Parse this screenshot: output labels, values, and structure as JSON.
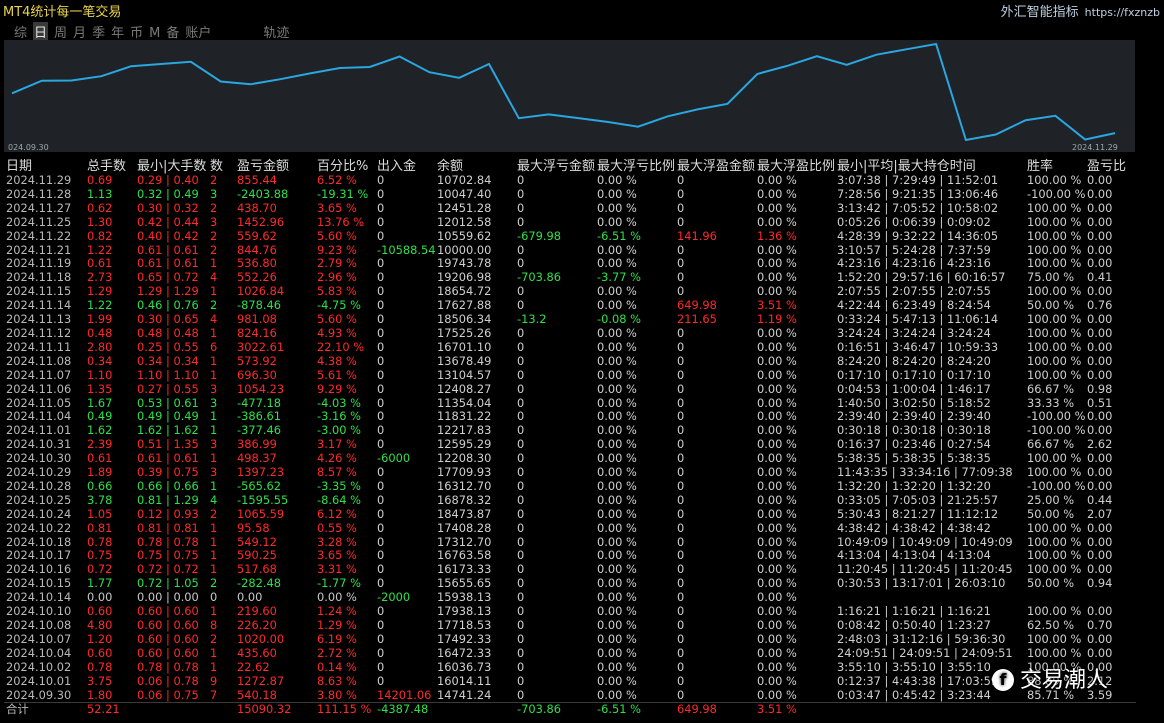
{
  "app_title": "MT4统计每一笔交易",
  "brand": "外汇智能指标",
  "brand_url": "https://fxznzb",
  "menu": [
    {
      "label": "综",
      "active": false
    },
    {
      "label": "日",
      "active": true
    },
    {
      "label": "周",
      "active": false
    },
    {
      "label": "月",
      "active": false
    },
    {
      "label": "季",
      "active": false
    },
    {
      "label": "年",
      "active": false
    },
    {
      "label": "币",
      "active": false
    },
    {
      "label": "M",
      "active": false
    },
    {
      "label": "备",
      "active": false
    },
    {
      "label": "账户",
      "active": false
    },
    {
      "label": "轨迹",
      "active": false,
      "gap": true
    }
  ],
  "chart_data": {
    "type": "line",
    "x_start_label": "024.09.30",
    "x_end_label": "2024.11.29",
    "x": [
      "2024.09.30",
      "2024.10.01",
      "2024.10.02",
      "2024.10.04",
      "2024.10.07",
      "2024.10.08",
      "2024.10.10",
      "2024.10.14",
      "2024.10.15",
      "2024.10.16",
      "2024.10.17",
      "2024.10.18",
      "2024.10.22",
      "2024.10.24",
      "2024.10.25",
      "2024.10.28",
      "2024.10.29",
      "2024.10.30",
      "2024.10.31",
      "2024.11.01",
      "2024.11.04",
      "2024.11.05",
      "2024.11.06",
      "2024.11.07",
      "2024.11.08",
      "2024.11.11",
      "2024.11.12",
      "2024.11.13",
      "2024.11.14",
      "2024.11.15",
      "2024.11.18",
      "2024.11.19",
      "2024.11.21",
      "2024.11.22",
      "2024.11.25",
      "2024.11.27",
      "2024.11.28",
      "2024.11.29"
    ],
    "values": [
      14741.24,
      16014.11,
      16036.73,
      16472.33,
      17492.33,
      17718.53,
      17938.13,
      15938.13,
      15655.65,
      16173.33,
      16763.58,
      17312.7,
      17408.28,
      18473.87,
      16878.32,
      16312.7,
      17709.93,
      12208.3,
      12595.29,
      12217.83,
      11831.22,
      11354.04,
      12408.27,
      13104.57,
      13678.49,
      16701.1,
      17525.26,
      18506.34,
      17627.88,
      18654.72,
      19206.98,
      19743.78,
      10000.0,
      10559.62,
      12012.58,
      12451.28,
      10047.4,
      10702.84
    ],
    "line_color": "#2aa6e0",
    "background": "#1f2226"
  },
  "table": {
    "columns": [
      "日期",
      "总手数",
      "最小|大手数",
      "数",
      "盈亏金额",
      "百分比%",
      "出入金",
      "余额",
      "最大浮亏金额",
      "最大浮亏比例",
      "最大浮盈金额",
      "最大浮盈比例",
      "最小|平均|最大持仓时间",
      "胜率",
      "盈亏比"
    ],
    "rows": [
      {
        "date": "2024.11.29",
        "lots": "0.69",
        "minmax": "0.29 | 0.40",
        "n": "2",
        "pl": "855.44",
        "pct": "6.52 %",
        "flow": "0",
        "bal": "10702.84",
        "mfl": "0",
        "mflp": "0.00 %",
        "mfp": "0",
        "mfpp": "0.00 %",
        "time": "3:07:38 | 7:29:49 | 11:52:01",
        "win": "100.00 %",
        "rr": "0.00",
        "sign": "neg"
      },
      {
        "date": "2024.11.28",
        "lots": "1.13",
        "minmax": "0.32 | 0.49",
        "n": "3",
        "pl": "-2403.88",
        "pct": "-19.31 %",
        "flow": "0",
        "bal": "10047.40",
        "mfl": "0",
        "mflp": "0.00 %",
        "mfp": "0",
        "mfpp": "0.00 %",
        "time": "7:28:56 | 9:21:35 | 13:06:46",
        "win": "-100.00 %",
        "rr": "0.00",
        "sign": "pos"
      },
      {
        "date": "2024.11.27",
        "lots": "0.62",
        "minmax": "0.30 | 0.32",
        "n": "2",
        "pl": "438.70",
        "pct": "3.65 %",
        "flow": "0",
        "bal": "12451.28",
        "mfl": "0",
        "mflp": "0.00 %",
        "mfp": "0",
        "mfpp": "0.00 %",
        "time": "3:13:42 | 7:05:52 | 10:58:02",
        "win": "100.00 %",
        "rr": "0.00",
        "sign": "neg"
      },
      {
        "date": "2024.11.25",
        "lots": "1.30",
        "minmax": "0.42 | 0.44",
        "n": "3",
        "pl": "1452.96",
        "pct": "13.76 %",
        "flow": "0",
        "bal": "12012.58",
        "mfl": "0",
        "mflp": "0.00 %",
        "mfp": "0",
        "mfpp": "0.00 %",
        "time": "0:05:26 | 0:06:39 | 0:09:02",
        "win": "100.00 %",
        "rr": "0.00",
        "sign": "neg"
      },
      {
        "date": "2024.11.22",
        "lots": "0.82",
        "minmax": "0.40 | 0.42",
        "n": "2",
        "pl": "559.62",
        "pct": "5.60 %",
        "flow": "0",
        "bal": "10559.62",
        "mfl": "-679.98",
        "mflp": "-6.51 %",
        "mfp": "141.96",
        "mfpp": "1.36 %",
        "time": "4:28:39 | 9:32:22 | 14:36:05",
        "win": "100.00 %",
        "rr": "0.00",
        "sign": "neg"
      },
      {
        "date": "2024.11.21",
        "lots": "1.22",
        "minmax": "0.61 | 0.61",
        "n": "2",
        "pl": "844.76",
        "pct": "9.23 %",
        "flow": "-10588.54",
        "bal": "10000.00",
        "mfl": "0",
        "mflp": "0.00 %",
        "mfp": "0",
        "mfpp": "0.00 %",
        "time": "3:10:57 | 5:24:28 | 7:37:59",
        "win": "100.00 %",
        "rr": "0.00",
        "sign": "neg"
      },
      {
        "date": "2024.11.19",
        "lots": "0.61",
        "minmax": "0.61 | 0.61",
        "n": "1",
        "pl": "536.80",
        "pct": "2.79 %",
        "flow": "0",
        "bal": "19743.78",
        "mfl": "0",
        "mflp": "0.00 %",
        "mfp": "0",
        "mfpp": "0.00 %",
        "time": "4:23:16 | 4:23:16 | 4:23:16",
        "win": "100.00 %",
        "rr": "0.00",
        "sign": "neg"
      },
      {
        "date": "2024.11.18",
        "lots": "2.73",
        "minmax": "0.65 | 0.72",
        "n": "4",
        "pl": "552.26",
        "pct": "2.96 %",
        "flow": "0",
        "bal": "19206.98",
        "mfl": "-703.86",
        "mflp": "-3.77 %",
        "mfp": "0",
        "mfpp": "0.00 %",
        "time": "1:52:20 | 29:57:16 | 60:16:57",
        "win": "75.00 %",
        "rr": "0.41",
        "sign": "neg"
      },
      {
        "date": "2024.11.15",
        "lots": "1.29",
        "minmax": "1.29 | 1.29",
        "n": "1",
        "pl": "1026.84",
        "pct": "5.83 %",
        "flow": "0",
        "bal": "18654.72",
        "mfl": "0",
        "mflp": "0.00 %",
        "mfp": "0",
        "mfpp": "0.00 %",
        "time": "2:07:55 | 2:07:55 | 2:07:55",
        "win": "100.00 %",
        "rr": "0.00",
        "sign": "neg"
      },
      {
        "date": "2024.11.14",
        "lots": "1.22",
        "minmax": "0.46 | 0.76",
        "n": "2",
        "pl": "-878.46",
        "pct": "-4.75 %",
        "flow": "0",
        "bal": "17627.88",
        "mfl": "0",
        "mflp": "0.00 %",
        "mfp": "649.98",
        "mfpp": "3.51 %",
        "time": "4:22:44 | 6:23:49 | 8:24:54",
        "win": "50.00 %",
        "rr": "0.76",
        "sign": "pos"
      },
      {
        "date": "2024.11.13",
        "lots": "1.99",
        "minmax": "0.30 | 0.65",
        "n": "4",
        "pl": "981.08",
        "pct": "5.60 %",
        "flow": "0",
        "bal": "18506.34",
        "mfl": "-13.2",
        "mflp": "-0.08 %",
        "mfp": "211.65",
        "mfpp": "1.19 %",
        "time": "0:33:24 | 5:47:13 | 11:06:14",
        "win": "100.00 %",
        "rr": "0.00",
        "sign": "neg"
      },
      {
        "date": "2024.11.12",
        "lots": "0.48",
        "minmax": "0.48 | 0.48",
        "n": "1",
        "pl": "824.16",
        "pct": "4.93 %",
        "flow": "0",
        "bal": "17525.26",
        "mfl": "0",
        "mflp": "0.00 %",
        "mfp": "0",
        "mfpp": "0.00 %",
        "time": "3:24:24 | 3:24:24 | 3:24:24",
        "win": "100.00 %",
        "rr": "0.00",
        "sign": "neg"
      },
      {
        "date": "2024.11.11",
        "lots": "2.80",
        "minmax": "0.25 | 0.55",
        "n": "6",
        "pl": "3022.61",
        "pct": "22.10 %",
        "flow": "0",
        "bal": "16701.10",
        "mfl": "0",
        "mflp": "0.00 %",
        "mfp": "0",
        "mfpp": "0.00 %",
        "time": "0:16:51 | 3:46:47 | 10:59:33",
        "win": "100.00 %",
        "rr": "0.00",
        "sign": "neg"
      },
      {
        "date": "2024.11.08",
        "lots": "0.34",
        "minmax": "0.34 | 0.34",
        "n": "1",
        "pl": "573.92",
        "pct": "4.38 %",
        "flow": "0",
        "bal": "13678.49",
        "mfl": "0",
        "mflp": "0.00 %",
        "mfp": "0",
        "mfpp": "0.00 %",
        "time": "8:24:20 | 8:24:20 | 8:24:20",
        "win": "100.00 %",
        "rr": "0.00",
        "sign": "neg"
      },
      {
        "date": "2024.11.07",
        "lots": "1.10",
        "minmax": "1.10 | 1.10",
        "n": "1",
        "pl": "696.30",
        "pct": "5.61 %",
        "flow": "0",
        "bal": "13104.57",
        "mfl": "0",
        "mflp": "0.00 %",
        "mfp": "0",
        "mfpp": "0.00 %",
        "time": "0:17:10 | 0:17:10 | 0:17:10",
        "win": "100.00 %",
        "rr": "0.00",
        "sign": "neg"
      },
      {
        "date": "2024.11.06",
        "lots": "1.35",
        "minmax": "0.27 | 0.55",
        "n": "3",
        "pl": "1054.23",
        "pct": "9.29 %",
        "flow": "0",
        "bal": "12408.27",
        "mfl": "0",
        "mflp": "0.00 %",
        "mfp": "0",
        "mfpp": "0.00 %",
        "time": "0:04:53 | 1:00:04 | 1:46:17",
        "win": "66.67 %",
        "rr": "0.98",
        "sign": "neg"
      },
      {
        "date": "2024.11.05",
        "lots": "1.67",
        "minmax": "0.53 | 0.61",
        "n": "3",
        "pl": "-477.18",
        "pct": "-4.03 %",
        "flow": "0",
        "bal": "11354.04",
        "mfl": "0",
        "mflp": "0.00 %",
        "mfp": "0",
        "mfpp": "0.00 %",
        "time": "1:40:50 | 3:02:50 | 5:18:52",
        "win": "33.33 %",
        "rr": "0.51",
        "sign": "pos"
      },
      {
        "date": "2024.11.04",
        "lots": "0.49",
        "minmax": "0.49 | 0.49",
        "n": "1",
        "pl": "-386.61",
        "pct": "-3.16 %",
        "flow": "0",
        "bal": "11831.22",
        "mfl": "0",
        "mflp": "0.00 %",
        "mfp": "0",
        "mfpp": "0.00 %",
        "time": "2:39:40 | 2:39:40 | 2:39:40",
        "win": "-100.00 %",
        "rr": "0.00",
        "sign": "pos"
      },
      {
        "date": "2024.11.01",
        "lots": "1.62",
        "minmax": "1.62 | 1.62",
        "n": "1",
        "pl": "-377.46",
        "pct": "-3.00 %",
        "flow": "0",
        "bal": "12217.83",
        "mfl": "0",
        "mflp": "0.00 %",
        "mfp": "0",
        "mfpp": "0.00 %",
        "time": "0:30:18 | 0:30:18 | 0:30:18",
        "win": "-100.00 %",
        "rr": "0.00",
        "sign": "pos"
      },
      {
        "date": "2024.10.31",
        "lots": "2.39",
        "minmax": "0.51 | 1.35",
        "n": "3",
        "pl": "386.99",
        "pct": "3.17 %",
        "flow": "0",
        "bal": "12595.29",
        "mfl": "0",
        "mflp": "0.00 %",
        "mfp": "0",
        "mfpp": "0.00 %",
        "time": "0:16:37 | 0:23:46 | 0:27:54",
        "win": "66.67 %",
        "rr": "2.62",
        "sign": "neg"
      },
      {
        "date": "2024.10.30",
        "lots": "0.61",
        "minmax": "0.61 | 0.61",
        "n": "1",
        "pl": "498.37",
        "pct": "4.26 %",
        "flow": "-6000",
        "bal": "12208.30",
        "mfl": "0",
        "mflp": "0.00 %",
        "mfp": "0",
        "mfpp": "0.00 %",
        "time": "5:38:35 | 5:38:35 | 5:38:35",
        "win": "100.00 %",
        "rr": "0.00",
        "sign": "neg"
      },
      {
        "date": "2024.10.29",
        "lots": "1.89",
        "minmax": "0.39 | 0.75",
        "n": "3",
        "pl": "1397.23",
        "pct": "8.57 %",
        "flow": "0",
        "bal": "17709.93",
        "mfl": "0",
        "mflp": "0.00 %",
        "mfp": "0",
        "mfpp": "0.00 %",
        "time": "11:43:35 | 33:34:16 | 77:09:38",
        "win": "100.00 %",
        "rr": "0.00",
        "sign": "neg"
      },
      {
        "date": "2024.10.28",
        "lots": "0.66",
        "minmax": "0.66 | 0.66",
        "n": "1",
        "pl": "-565.62",
        "pct": "-3.35 %",
        "flow": "0",
        "bal": "16312.70",
        "mfl": "0",
        "mflp": "0.00 %",
        "mfp": "0",
        "mfpp": "0.00 %",
        "time": "1:32:20 | 1:32:20 | 1:32:20",
        "win": "-100.00 %",
        "rr": "0.00",
        "sign": "pos"
      },
      {
        "date": "2024.10.25",
        "lots": "3.78",
        "minmax": "0.81 | 1.29",
        "n": "4",
        "pl": "-1595.55",
        "pct": "-8.64 %",
        "flow": "0",
        "bal": "16878.32",
        "mfl": "0",
        "mflp": "0.00 %",
        "mfp": "0",
        "mfpp": "0.00 %",
        "time": "0:33:05 | 7:05:03 | 21:25:57",
        "win": "25.00 %",
        "rr": "0.44",
        "sign": "pos"
      },
      {
        "date": "2024.10.24",
        "lots": "1.05",
        "minmax": "0.12 | 0.93",
        "n": "2",
        "pl": "1065.59",
        "pct": "6.12 %",
        "flow": "0",
        "bal": "18473.87",
        "mfl": "0",
        "mflp": "0.00 %",
        "mfp": "0",
        "mfpp": "0.00 %",
        "time": "5:30:43 | 8:21:27 | 11:12:12",
        "win": "50.00 %",
        "rr": "2.07",
        "sign": "neg"
      },
      {
        "date": "2024.10.22",
        "lots": "0.81",
        "minmax": "0.81 | 0.81",
        "n": "1",
        "pl": "95.58",
        "pct": "0.55 %",
        "flow": "0",
        "bal": "17408.28",
        "mfl": "0",
        "mflp": "0.00 %",
        "mfp": "0",
        "mfpp": "0.00 %",
        "time": "4:38:42 | 4:38:42 | 4:38:42",
        "win": "100.00 %",
        "rr": "0.00",
        "sign": "neg"
      },
      {
        "date": "2024.10.18",
        "lots": "0.78",
        "minmax": "0.78 | 0.78",
        "n": "1",
        "pl": "549.12",
        "pct": "3.28 %",
        "flow": "0",
        "bal": "17312.70",
        "mfl": "0",
        "mflp": "0.00 %",
        "mfp": "0",
        "mfpp": "0.00 %",
        "time": "10:49:09 | 10:49:09 | 10:49:09",
        "win": "100.00 %",
        "rr": "0.00",
        "sign": "neg"
      },
      {
        "date": "2024.10.17",
        "lots": "0.75",
        "minmax": "0.75 | 0.75",
        "n": "1",
        "pl": "590.25",
        "pct": "3.65 %",
        "flow": "0",
        "bal": "16763.58",
        "mfl": "0",
        "mflp": "0.00 %",
        "mfp": "0",
        "mfpp": "0.00 %",
        "time": "4:13:04 | 4:13:04 | 4:13:04",
        "win": "100.00 %",
        "rr": "0.00",
        "sign": "neg"
      },
      {
        "date": "2024.10.16",
        "lots": "0.72",
        "minmax": "0.72 | 0.72",
        "n": "1",
        "pl": "517.68",
        "pct": "3.31 %",
        "flow": "0",
        "bal": "16173.33",
        "mfl": "0",
        "mflp": "0.00 %",
        "mfp": "0",
        "mfpp": "0.00 %",
        "time": "11:20:45 | 11:20:45 | 11:20:45",
        "win": "100.00 %",
        "rr": "0.00",
        "sign": "neg"
      },
      {
        "date": "2024.10.15",
        "lots": "1.77",
        "minmax": "0.72 | 1.05",
        "n": "2",
        "pl": "-282.48",
        "pct": "-1.77 %",
        "flow": "0",
        "bal": "15655.65",
        "mfl": "0",
        "mflp": "0.00 %",
        "mfp": "0",
        "mfpp": "0.00 %",
        "time": "0:30:53 | 13:17:01 | 26:03:10",
        "win": "50.00 %",
        "rr": "0.94",
        "sign": "pos"
      },
      {
        "date": "2024.10.14",
        "lots": "0.00",
        "minmax": "0.00 | 0.00",
        "n": "0",
        "pl": "0.00",
        "pct": "0.00 %",
        "flow": "-2000",
        "bal": "15938.13",
        "mfl": "0",
        "mflp": "0.00 %",
        "mfp": "0",
        "mfpp": "0.00 %",
        "time": "",
        "win": "",
        "rr": "",
        "sign": "zero"
      },
      {
        "date": "2024.10.10",
        "lots": "0.60",
        "minmax": "0.60 | 0.60",
        "n": "1",
        "pl": "219.60",
        "pct": "1.24 %",
        "flow": "0",
        "bal": "17938.13",
        "mfl": "0",
        "mflp": "0.00 %",
        "mfp": "0",
        "mfpp": "0.00 %",
        "time": "1:16:21 | 1:16:21 | 1:16:21",
        "win": "100.00 %",
        "rr": "0.00",
        "sign": "neg"
      },
      {
        "date": "2024.10.08",
        "lots": "4.80",
        "minmax": "0.60 | 0.60",
        "n": "8",
        "pl": "226.20",
        "pct": "1.29 %",
        "flow": "0",
        "bal": "17718.53",
        "mfl": "0",
        "mflp": "0.00 %",
        "mfp": "0",
        "mfpp": "0.00 %",
        "time": "0:08:42 | 0:50:40 | 1:23:27",
        "win": "62.50 %",
        "rr": "0.70",
        "sign": "neg"
      },
      {
        "date": "2024.10.07",
        "lots": "1.20",
        "minmax": "0.60 | 0.60",
        "n": "2",
        "pl": "1020.00",
        "pct": "6.19 %",
        "flow": "0",
        "bal": "17492.33",
        "mfl": "0",
        "mflp": "0.00 %",
        "mfp": "0",
        "mfpp": "0.00 %",
        "time": "2:48:03 | 31:12:16 | 59:36:30",
        "win": "100.00 %",
        "rr": "0.00",
        "sign": "neg"
      },
      {
        "date": "2024.10.04",
        "lots": "0.60",
        "minmax": "0.60 | 0.60",
        "n": "1",
        "pl": "435.60",
        "pct": "2.72 %",
        "flow": "0",
        "bal": "16472.33",
        "mfl": "0",
        "mflp": "0.00 %",
        "mfp": "0",
        "mfpp": "0.00 %",
        "time": "24:09:51 | 24:09:51 | 24:09:51",
        "win": "100.00 %",
        "rr": "0.00",
        "sign": "neg"
      },
      {
        "date": "2024.10.02",
        "lots": "0.78",
        "minmax": "0.78 | 0.78",
        "n": "1",
        "pl": "22.62",
        "pct": "0.14 %",
        "flow": "0",
        "bal": "16036.73",
        "mfl": "0",
        "mflp": "0.00 %",
        "mfp": "0",
        "mfpp": "0.00 %",
        "time": "3:55:10 | 3:55:10 | 3:55:10",
        "win": "100.00 %",
        "rr": "0.00",
        "sign": "neg"
      },
      {
        "date": "2024.10.01",
        "lots": "3.75",
        "minmax": "0.06 | 0.78",
        "n": "9",
        "pl": "1272.87",
        "pct": "8.63 %",
        "flow": "0",
        "bal": "16014.11",
        "mfl": "0",
        "mflp": "0.00 %",
        "mfp": "0",
        "mfpp": "0.00 %",
        "time": "0:12:37 | 4:43:38 | 17:03:59",
        "win": "88.89 %",
        "rr": "2.12",
        "sign": "neg"
      },
      {
        "date": "2024.09.30",
        "lots": "1.80",
        "minmax": "0.06 | 0.75",
        "n": "7",
        "pl": "540.18",
        "pct": "3.80 %",
        "flow": "14201.06",
        "bal": "14741.24",
        "mfl": "0",
        "mflp": "0.00 %",
        "mfp": "0",
        "mfpp": "0.00 %",
        "time": "0:03:47 | 0:45:42 | 3:23:44",
        "win": "85.71 %",
        "rr": "3.59",
        "sign": "neg"
      }
    ],
    "total": {
      "label": "合计",
      "lots": "52.21",
      "pl": "15090.32",
      "pct": "111.15 %",
      "flow": "-4387.48",
      "mfl": "-703.86",
      "mflp": "-6.51 %",
      "mfp": "649.98",
      "mfpp": "3.51 %"
    }
  },
  "watermark": "交易潮人"
}
